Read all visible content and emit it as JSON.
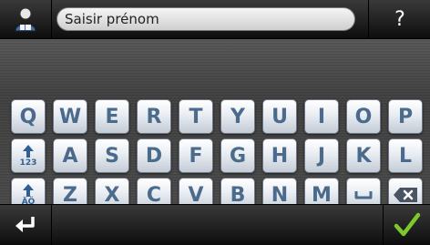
{
  "header": {
    "user_icon": "user-icon",
    "input_value": "Saisir prénom",
    "help_label": "?"
  },
  "keyboard": {
    "row1": [
      "Q",
      "W",
      "E",
      "R",
      "T",
      "Y",
      "U",
      "I",
      "O",
      "P"
    ],
    "row2": [
      "A",
      "S",
      "D",
      "F",
      "G",
      "H",
      "J",
      "K",
      "L"
    ],
    "row3": [
      "Z",
      "X",
      "C",
      "V",
      "B",
      "N",
      "M"
    ],
    "shift_numbers_label": "123",
    "shift_accents_label": "ÄÖ",
    "space_icon": "space-icon",
    "backspace_icon": "backspace-icon"
  },
  "footer": {
    "enter_icon": "enter-icon",
    "confirm_icon": "checkmark-icon"
  },
  "colors": {
    "key_text": "#4a6b8c",
    "confirm": "#7ec82a"
  }
}
